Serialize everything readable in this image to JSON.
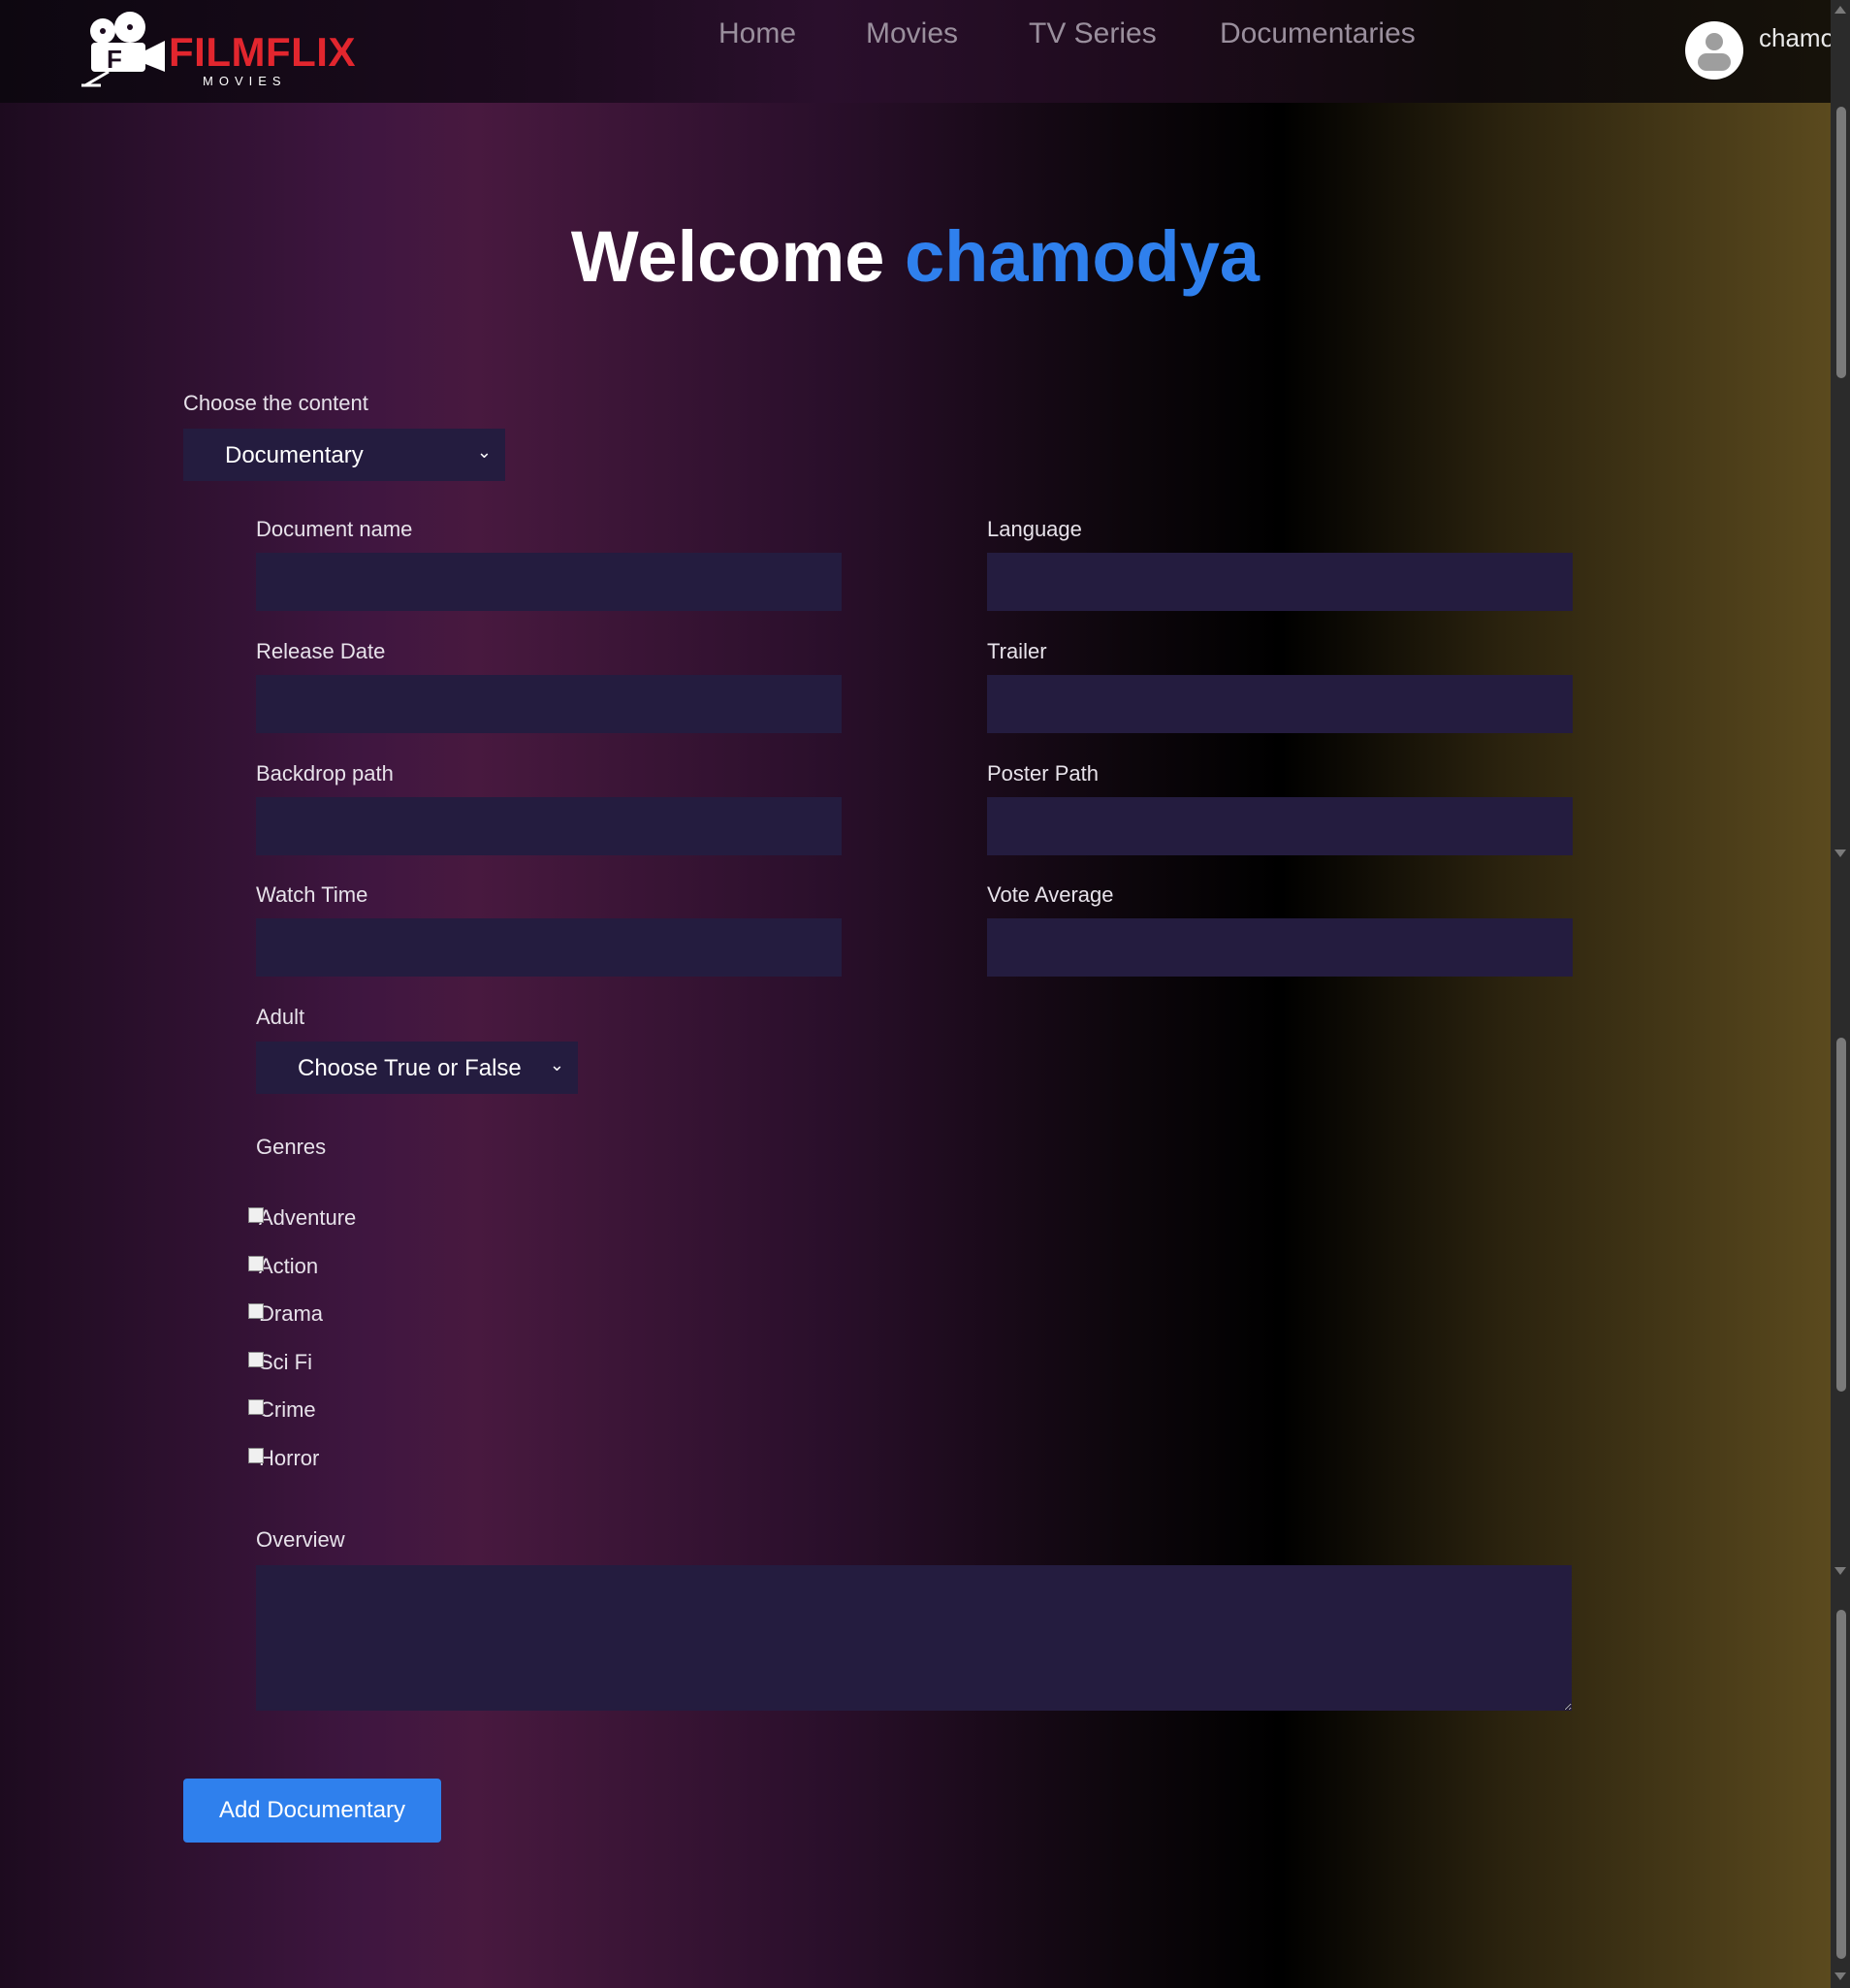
{
  "brand": {
    "name": "FILMFLIX",
    "tagline": "MOVIES",
    "accent_color": "#e2262e"
  },
  "nav": {
    "items": [
      "Home",
      "Movies",
      "TV Series",
      "Documentaries"
    ]
  },
  "user": {
    "name": "chamodya",
    "avatar_icon": "user-avatar-icon"
  },
  "welcome": {
    "greeting": "Welcome",
    "name": "chamodya",
    "name_color": "#2f80ed"
  },
  "content_select": {
    "label": "Choose the content",
    "value": "Documentary"
  },
  "form": {
    "document_name": {
      "label": "Document name",
      "value": ""
    },
    "language": {
      "label": "Language",
      "value": ""
    },
    "release_date": {
      "label": "Release Date",
      "value": ""
    },
    "trailer": {
      "label": "Trailer",
      "value": ""
    },
    "backdrop_path": {
      "label": "Backdrop path",
      "value": ""
    },
    "poster_path": {
      "label": "Poster Path",
      "value": ""
    },
    "watch_time": {
      "label": "Watch Time",
      "value": ""
    },
    "vote_average": {
      "label": "Vote Average",
      "value": ""
    },
    "adult": {
      "label": "Adult",
      "value": "Choose True or False"
    },
    "genres": {
      "label": "Genres",
      "options": [
        "Adventure",
        "Action",
        "Drama",
        "Sci Fi",
        "Crime",
        "Horror"
      ]
    },
    "overview": {
      "label": "Overview",
      "value": ""
    },
    "submit_label": "Add Documentary",
    "field_color": "#241c3f"
  }
}
